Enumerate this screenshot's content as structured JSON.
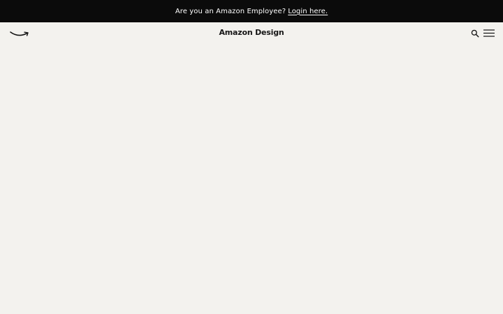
{
  "announcement": {
    "message": "Are you an Amazon Employee?",
    "login_link": "Login here."
  },
  "header": {
    "site_title": "Amazon Design",
    "logo_icon": "amazon-smile-icon",
    "search_icon": "search-icon",
    "menu_icon": "hamburger-menu-icon"
  },
  "colors": {
    "announce_bg": "#0b0b0b",
    "page_bg": "#f3f2ee",
    "text": "#161616"
  }
}
